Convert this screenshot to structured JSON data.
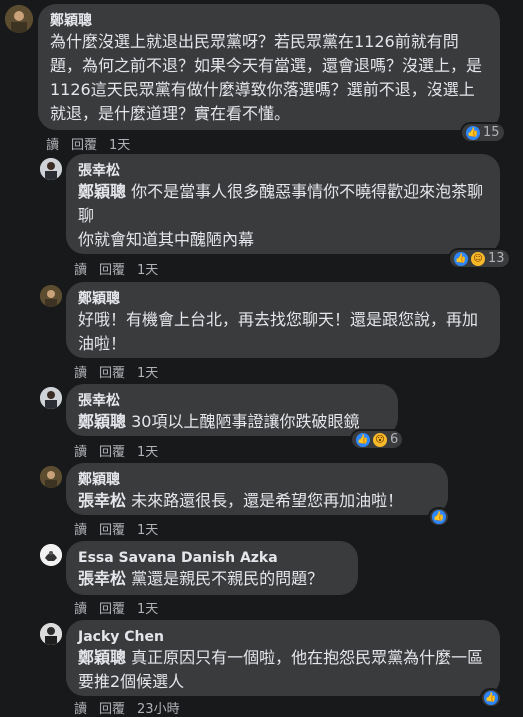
{
  "actions": {
    "read": "讀",
    "reply": "回覆"
  },
  "comments": [
    {
      "author": "鄭穎聰",
      "text": "為什麼沒選上就退出民眾黨呀？若民眾黨在1126前就有問題，為何之前不退？如果今天有當選，還會退嗎？沒選上，是1126這天民眾黨有做什麼導致你落選嗎？選前不退，沒選上就退，是什麼道理？實在看不懂。",
      "time": "1天",
      "reactions": "15"
    },
    {
      "author": "張幸松",
      "mention": "鄭穎聰",
      "text": " 你不是當事人很多醜惡事情你不曉得歡迎來泡茶聊聊\n你就會知道其中醜陋內幕",
      "time": "1天",
      "reactions": "13"
    },
    {
      "author": "鄭穎聰",
      "text": "好哦！有機會上台北，再去找您聊天！還是跟您說，再加油啦！",
      "time": "1天"
    },
    {
      "author": "張幸松",
      "mention": "鄭穎聰",
      "text": " 30項以上醜陋事證讓你跌破眼鏡",
      "time": "1天",
      "reactions": "6"
    },
    {
      "author": "鄭穎聰",
      "mention": "張幸松",
      "text": " 未來路還很長，還是希望您再加油啦！",
      "time": "1天"
    },
    {
      "author": "Essa Savana Danish Azka",
      "mention": "張幸松",
      "text": " 黨還是親民不親民的問題？",
      "time": "1天"
    },
    {
      "author": "Jacky Chen",
      "mention": "鄭穎聰",
      "text": " 真正原因只有一個啦，他在抱怨民眾黨為什麼一區要推2個候選人",
      "time": "23小時"
    }
  ]
}
